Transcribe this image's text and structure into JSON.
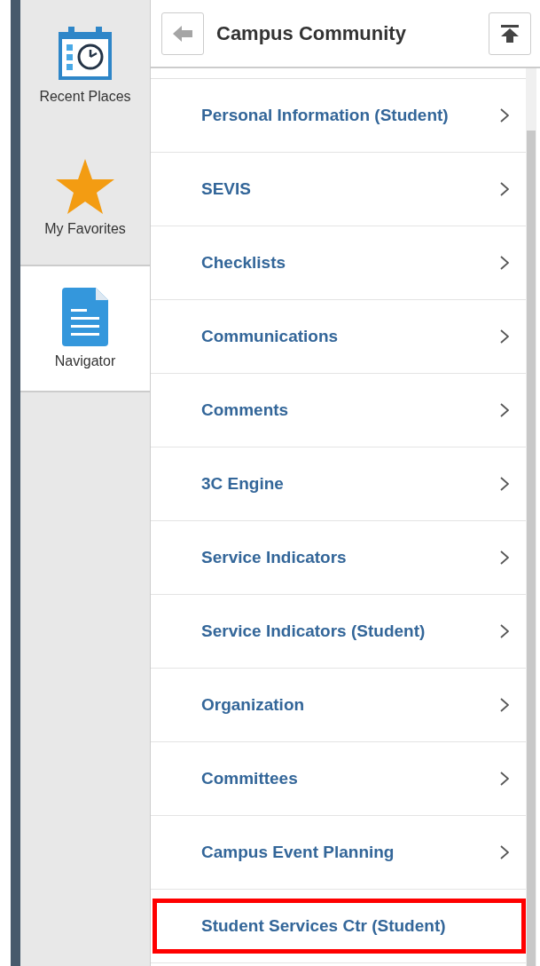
{
  "sidebar": {
    "tabs": [
      {
        "label": "Recent Places",
        "kind": "calendar",
        "selected": false
      },
      {
        "label": "My Favorites",
        "kind": "star",
        "selected": false
      },
      {
        "label": "Navigator",
        "kind": "document",
        "selected": true
      }
    ]
  },
  "header": {
    "title": "Campus Community"
  },
  "items": [
    {
      "label": "Personal Information (Student)",
      "has_arrow": true,
      "highlighted": false
    },
    {
      "label": "SEVIS",
      "has_arrow": true,
      "highlighted": false
    },
    {
      "label": "Checklists",
      "has_arrow": true,
      "highlighted": false
    },
    {
      "label": "Communications",
      "has_arrow": true,
      "highlighted": false
    },
    {
      "label": "Comments",
      "has_arrow": true,
      "highlighted": false
    },
    {
      "label": "3C Engine",
      "has_arrow": true,
      "highlighted": false
    },
    {
      "label": "Service Indicators",
      "has_arrow": true,
      "highlighted": false
    },
    {
      "label": "Service Indicators (Student)",
      "has_arrow": true,
      "highlighted": false
    },
    {
      "label": "Organization",
      "has_arrow": true,
      "highlighted": false
    },
    {
      "label": "Committees",
      "has_arrow": true,
      "highlighted": false
    },
    {
      "label": "Campus Event Planning",
      "has_arrow": true,
      "highlighted": false
    },
    {
      "label": "Student Services Ctr (Student)",
      "has_arrow": false,
      "highlighted": true
    }
  ]
}
